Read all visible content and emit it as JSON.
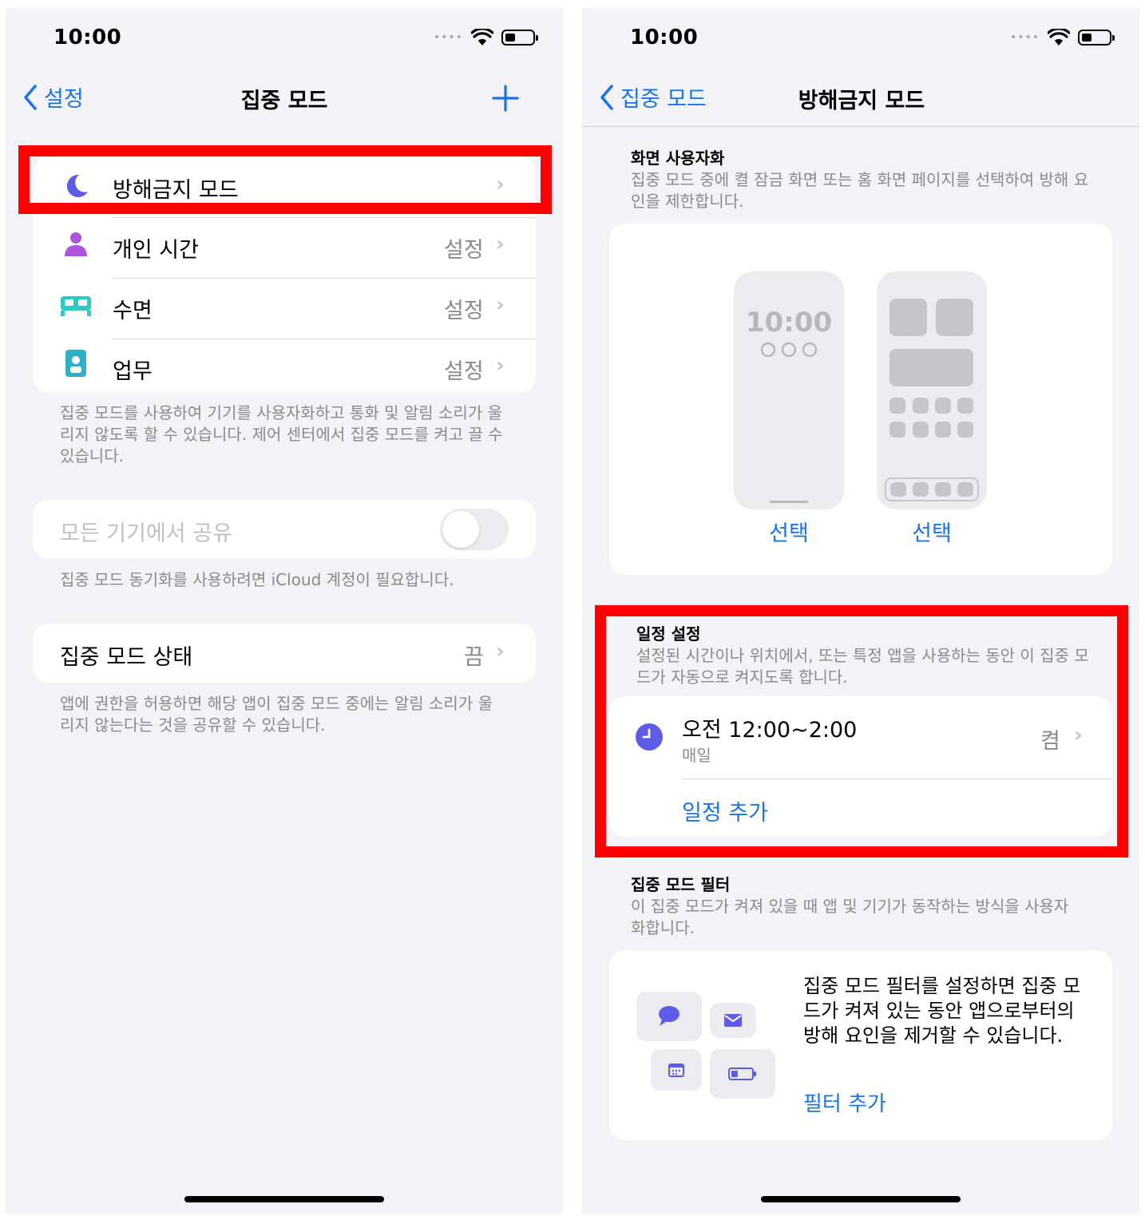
{
  "left": {
    "status": {
      "time": "10:00",
      "signal_dots": "•••• "
    },
    "nav": {
      "back_label": "설정",
      "title": "집중 모드",
      "add_icon": "plus-icon"
    },
    "modes": [
      {
        "label": "방해금지 모드",
        "value": "",
        "icon": "moon-icon",
        "color": "#5e5ce6"
      },
      {
        "label": "개인 시간",
        "value": "설정",
        "icon": "person-icon",
        "color": "#af52de"
      },
      {
        "label": "수면",
        "value": "설정",
        "icon": "bed-icon",
        "color": "#30c8c0"
      },
      {
        "label": "업무",
        "value": "설정",
        "icon": "id-badge-icon",
        "color": "#30b0c7"
      }
    ],
    "modes_footer": "집중 모드를 사용하여 기기를 사용자화하고 통화 및 알림 소리가 울리지 않도록 할 수 있습니다. 제어 센터에서 집중 모드를 켜고 끌 수 있습니다.",
    "share": {
      "label": "모든 기기에서 공유",
      "on": false
    },
    "share_footer": "집중 모드 동기화를 사용하려면 iCloud 계정이 필요합니다.",
    "focus_status": {
      "label": "집중 모드 상태",
      "value": "끔"
    },
    "focus_status_footer": "앱에 권한을 허용하면 해당 앱이 집중 모드 중에는 알림 소리가 울리지 않는다는 것을 공유할 수 있습니다."
  },
  "right": {
    "status": {
      "time": "10:00",
      "signal_dots": "•••• "
    },
    "nav": {
      "back_label": "집중 모드",
      "title": "방해금지 모드"
    },
    "customize": {
      "header": "화면 사용자화",
      "desc": "집중 모드 중에 켤 잠금 화면 또는 홈 화면 페이지를 선택하여 방해 요인을 제한합니다.",
      "lock_time": "10:00",
      "lock_choose": "선택",
      "home_choose": "선택"
    },
    "schedule": {
      "header": "일정 설정",
      "desc": "설정된 시간이나 위치에서, 또는 특정 앱을 사용하는 동안 이 집중 모드가 자동으로 켜지도록 합니다.",
      "item_title": "오전 12:00~2:00",
      "item_sub": "매일",
      "item_value": "켬",
      "add_label": "일정 추가"
    },
    "filters": {
      "header": "집중 모드 필터",
      "desc": "이 집중 모드가 켜져 있을 때 앱 및 기기가 동작하는 방식을 사용자화합니다.",
      "body": "집중 모드 필터를 설정하면 집중 모드가 켜져 있는 동안 앱으로부터의 방해 요인을 제거할 수 있습니다.",
      "add_label": "필터 추가"
    }
  },
  "colors": {
    "accent": "#1a73e8",
    "highlight": "#ff0000",
    "purple": "#5e5ce6"
  }
}
